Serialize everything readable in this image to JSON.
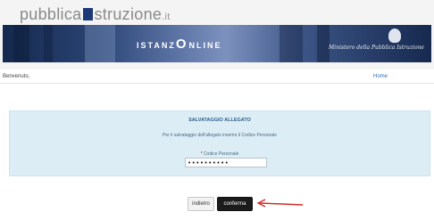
{
  "header": {
    "logo_part1": "pubblica",
    "logo_part2": "struzione",
    "logo_tld": ".it",
    "banner_title": "ISTANZ",
    "banner_title_2": "NLINE",
    "banner_o": "O",
    "ministry": "Ministero della Pubblica Istruzione"
  },
  "nav": {
    "welcome": "Benvenuto,",
    "home": "Home"
  },
  "panel": {
    "title": "SALVATAGGIO ALLEGATO",
    "description": "Per il salvataggio dell'allegato inserire il Codice Personale",
    "field_label": "Codice Personale",
    "required_mark": "*",
    "field_value": "••••••••••"
  },
  "actions": {
    "back_label": "indietro",
    "confirm_label": "conferma"
  },
  "colors": {
    "accent": "#1b1b1b",
    "panel_bg": "#dcedf5",
    "arrow": "#d62b2b"
  }
}
